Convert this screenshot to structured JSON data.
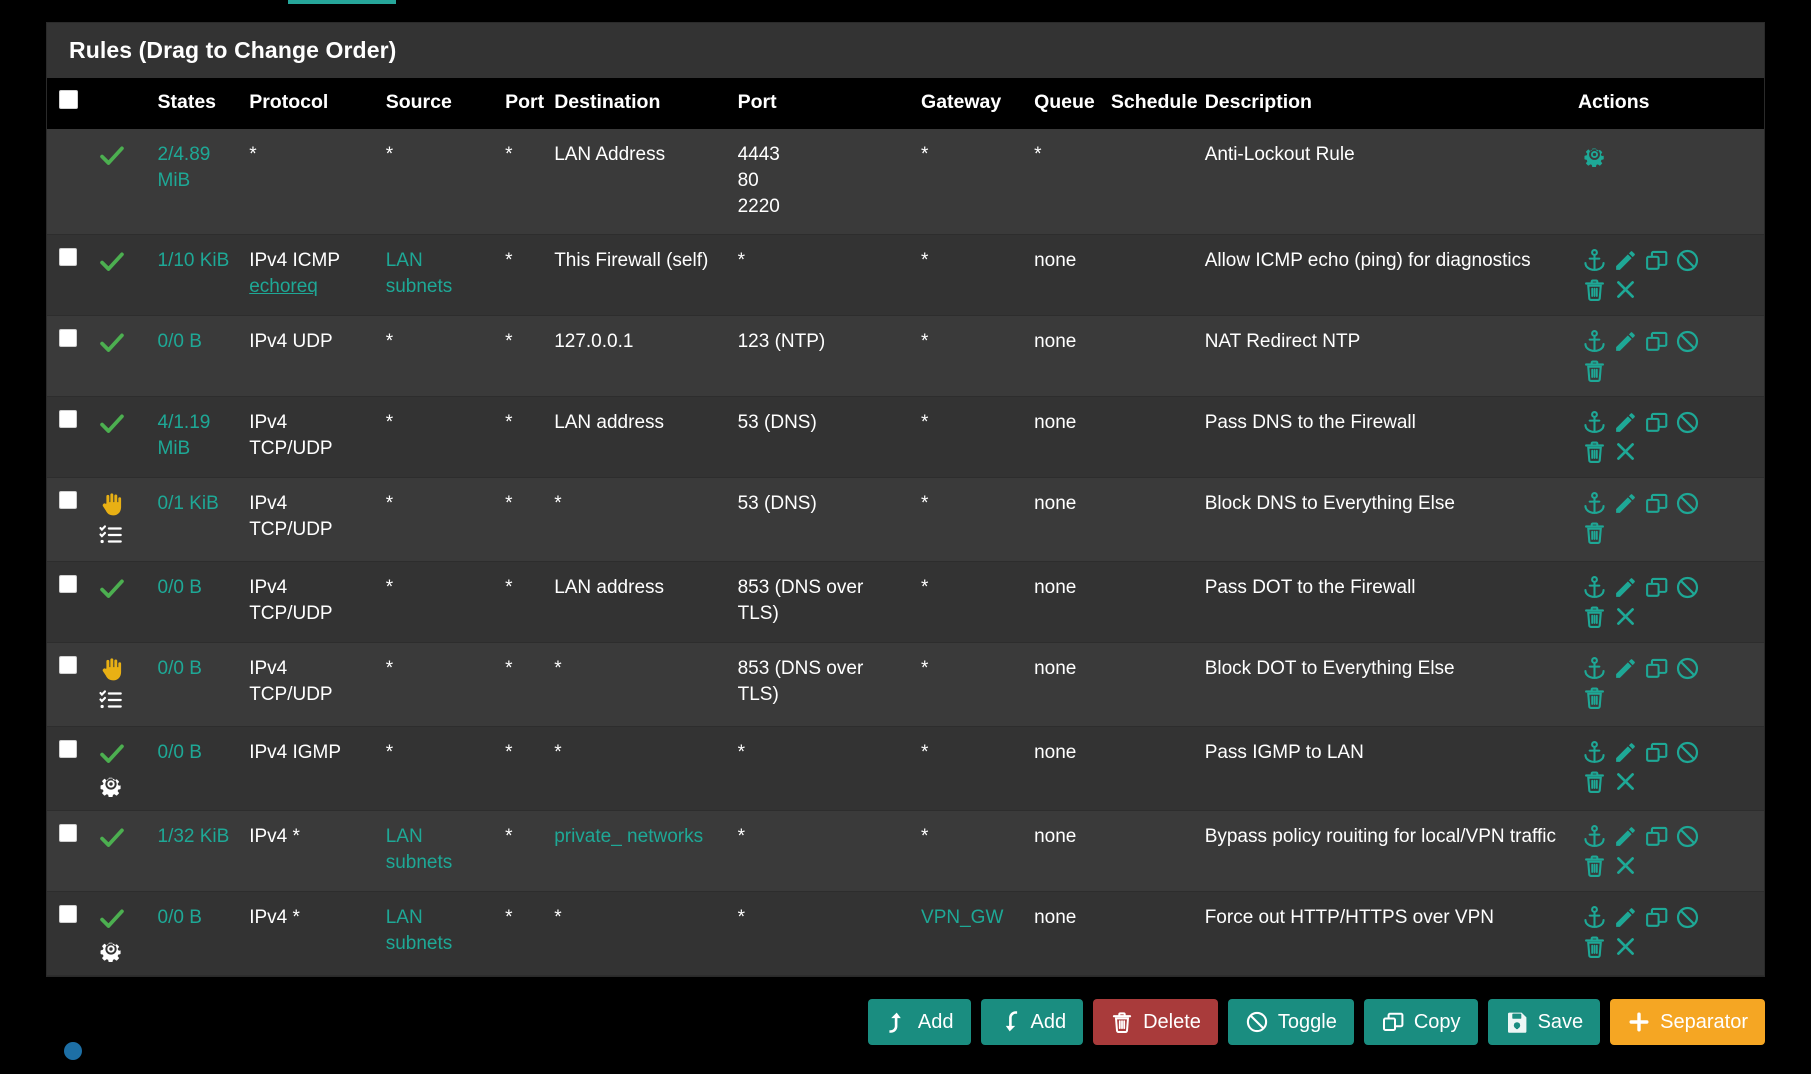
{
  "panel": {
    "title": "Rules (Drag to Change Order)"
  },
  "table": {
    "headers": {
      "checkbox": "",
      "status": "",
      "states": "States",
      "protocol": "Protocol",
      "source": "Source",
      "source_port": "Port",
      "destination": "Destination",
      "dest_port": "Port",
      "gateway": "Gateway",
      "queue": "Queue",
      "schedule": "Schedule",
      "description": "Description",
      "actions": "Actions"
    },
    "rows": [
      {
        "has_checkbox": false,
        "status_icon": "check-pass-icon",
        "extra_icon": null,
        "states": "2/4.89 MiB",
        "protocol": "*",
        "protocol_sub": null,
        "source": "*",
        "source_link": false,
        "source_port": "*",
        "destination": "LAN Address",
        "destination_link": false,
        "dest_port": "4443\n80\n2220",
        "gateway": "*",
        "gateway_link": false,
        "queue": "*",
        "schedule": "",
        "description": "Anti-Lockout Rule",
        "actions": [
          "gear-icon"
        ]
      },
      {
        "has_checkbox": true,
        "status_icon": "check-pass-icon",
        "extra_icon": null,
        "states": "1/10 KiB",
        "protocol": "IPv4 ICMP",
        "protocol_sub": "echoreq",
        "source": "LAN subnets",
        "source_link": true,
        "source_port": "*",
        "destination": "This Firewall (self)",
        "destination_link": false,
        "dest_port": "*",
        "gateway": "*",
        "gateway_link": false,
        "queue": "none",
        "schedule": "",
        "description": "Allow ICMP echo (ping) for diagnostics",
        "actions": [
          "anchor-icon",
          "pencil-icon",
          "copy-icon",
          "ban-icon",
          "trash-icon",
          "x-icon"
        ]
      },
      {
        "has_checkbox": true,
        "status_icon": "check-pass-icon",
        "extra_icon": null,
        "states": "0/0 B",
        "protocol": "IPv4 UDP",
        "protocol_sub": null,
        "source": "*",
        "source_link": false,
        "source_port": "*",
        "destination": "127.0.0.1",
        "destination_link": false,
        "dest_port": "123 (NTP)",
        "gateway": "*",
        "gateway_link": false,
        "queue": "none",
        "schedule": "",
        "description": "NAT Redirect NTP",
        "actions": [
          "anchor-icon",
          "pencil-icon",
          "copy-icon",
          "ban-icon",
          "trash-icon"
        ]
      },
      {
        "has_checkbox": true,
        "status_icon": "check-pass-icon",
        "extra_icon": null,
        "states": "4/1.19 MiB",
        "protocol": "IPv4 TCP/UDP",
        "protocol_sub": null,
        "source": "*",
        "source_link": false,
        "source_port": "*",
        "destination": "LAN address",
        "destination_link": false,
        "dest_port": "53 (DNS)",
        "gateway": "*",
        "gateway_link": false,
        "queue": "none",
        "schedule": "",
        "description": "Pass DNS to the Firewall",
        "actions": [
          "anchor-icon",
          "pencil-icon",
          "copy-icon",
          "ban-icon",
          "trash-icon",
          "x-icon"
        ]
      },
      {
        "has_checkbox": true,
        "status_icon": "block-hand-icon",
        "extra_icon": "log-list-icon",
        "states": "0/1 KiB",
        "protocol": "IPv4 TCP/UDP",
        "protocol_sub": null,
        "source": "*",
        "source_link": false,
        "source_port": "*",
        "destination": "*",
        "destination_link": false,
        "dest_port": "53 (DNS)",
        "gateway": "*",
        "gateway_link": false,
        "queue": "none",
        "schedule": "",
        "description": "Block DNS to Everything Else",
        "actions": [
          "anchor-icon",
          "pencil-icon",
          "copy-icon",
          "ban-icon",
          "trash-icon"
        ]
      },
      {
        "has_checkbox": true,
        "status_icon": "check-pass-icon",
        "extra_icon": null,
        "states": "0/0 B",
        "protocol": "IPv4 TCP/UDP",
        "protocol_sub": null,
        "source": "*",
        "source_link": false,
        "source_port": "*",
        "destination": "LAN address",
        "destination_link": false,
        "dest_port": "853 (DNS over TLS)",
        "gateway": "*",
        "gateway_link": false,
        "queue": "none",
        "schedule": "",
        "description": "Pass DOT to the Firewall",
        "actions": [
          "anchor-icon",
          "pencil-icon",
          "copy-icon",
          "ban-icon",
          "trash-icon",
          "x-icon"
        ]
      },
      {
        "has_checkbox": true,
        "status_icon": "block-hand-icon",
        "extra_icon": "log-list-icon",
        "states": "0/0 B",
        "protocol": "IPv4 TCP/UDP",
        "protocol_sub": null,
        "source": "*",
        "source_link": false,
        "source_port": "*",
        "destination": "*",
        "destination_link": false,
        "dest_port": "853 (DNS over TLS)",
        "gateway": "*",
        "gateway_link": false,
        "queue": "none",
        "schedule": "",
        "description": "Block DOT to Everything Else",
        "actions": [
          "anchor-icon",
          "pencil-icon",
          "copy-icon",
          "ban-icon",
          "trash-icon"
        ]
      },
      {
        "has_checkbox": true,
        "status_icon": "check-pass-icon",
        "extra_icon": "gear-white-icon",
        "states": "0/0 B",
        "protocol": "IPv4 IGMP",
        "protocol_sub": null,
        "source": "*",
        "source_link": false,
        "source_port": "*",
        "destination": "*",
        "destination_link": false,
        "dest_port": "*",
        "gateway": "*",
        "gateway_link": false,
        "queue": "none",
        "schedule": "",
        "description": "Pass IGMP to LAN",
        "actions": [
          "anchor-icon",
          "pencil-icon",
          "copy-icon",
          "ban-icon",
          "trash-icon",
          "x-icon"
        ]
      },
      {
        "has_checkbox": true,
        "status_icon": "check-pass-icon",
        "extra_icon": null,
        "states": "1/32 KiB",
        "protocol": "IPv4 *",
        "protocol_sub": null,
        "source": "LAN subnets",
        "source_link": true,
        "source_port": "*",
        "destination": "private_ networks",
        "destination_link": true,
        "dest_port": "*",
        "gateway": "*",
        "gateway_link": false,
        "queue": "none",
        "schedule": "",
        "description": "Bypass policy rouiting for local/VPN traffic",
        "actions": [
          "anchor-icon",
          "pencil-icon",
          "copy-icon",
          "ban-icon",
          "trash-icon",
          "x-icon"
        ]
      },
      {
        "has_checkbox": true,
        "status_icon": "check-pass-icon",
        "extra_icon": "gear-white-icon",
        "states": "0/0 B",
        "protocol": "IPv4 *",
        "protocol_sub": null,
        "source": "LAN subnets",
        "source_link": true,
        "source_port": "*",
        "destination": "*",
        "destination_link": false,
        "dest_port": "*",
        "gateway": "VPN_GW",
        "gateway_link": true,
        "queue": "none",
        "schedule": "",
        "description": "Force out HTTP/HTTPS over VPN",
        "actions": [
          "anchor-icon",
          "pencil-icon",
          "copy-icon",
          "ban-icon",
          "trash-icon",
          "x-icon"
        ]
      }
    ]
  },
  "buttons": [
    {
      "label": "Add",
      "icon": "arrow-up-add-icon",
      "style": "btn-teal"
    },
    {
      "label": "Add",
      "icon": "arrow-down-add-icon",
      "style": "btn-teal"
    },
    {
      "label": "Delete",
      "icon": "trash-icon",
      "style": "btn-red"
    },
    {
      "label": "Toggle",
      "icon": "ban-icon",
      "style": "btn-teal"
    },
    {
      "label": "Copy",
      "icon": "copy-icon",
      "style": "btn-teal"
    },
    {
      "label": "Save",
      "icon": "floppy-save-icon",
      "style": "btn-teal"
    },
    {
      "label": "Separator",
      "icon": "plus-icon",
      "style": "btn-orange"
    }
  ],
  "colors": {
    "accent_teal": "#1ea896",
    "pass_green": "#4caf50",
    "block_yellow": "#e8b014",
    "separator_orange": "#f5a623",
    "delete_red": "#a93b3b",
    "panel_bg": "#333333",
    "row_alt_bg": "#3a3a3a"
  }
}
